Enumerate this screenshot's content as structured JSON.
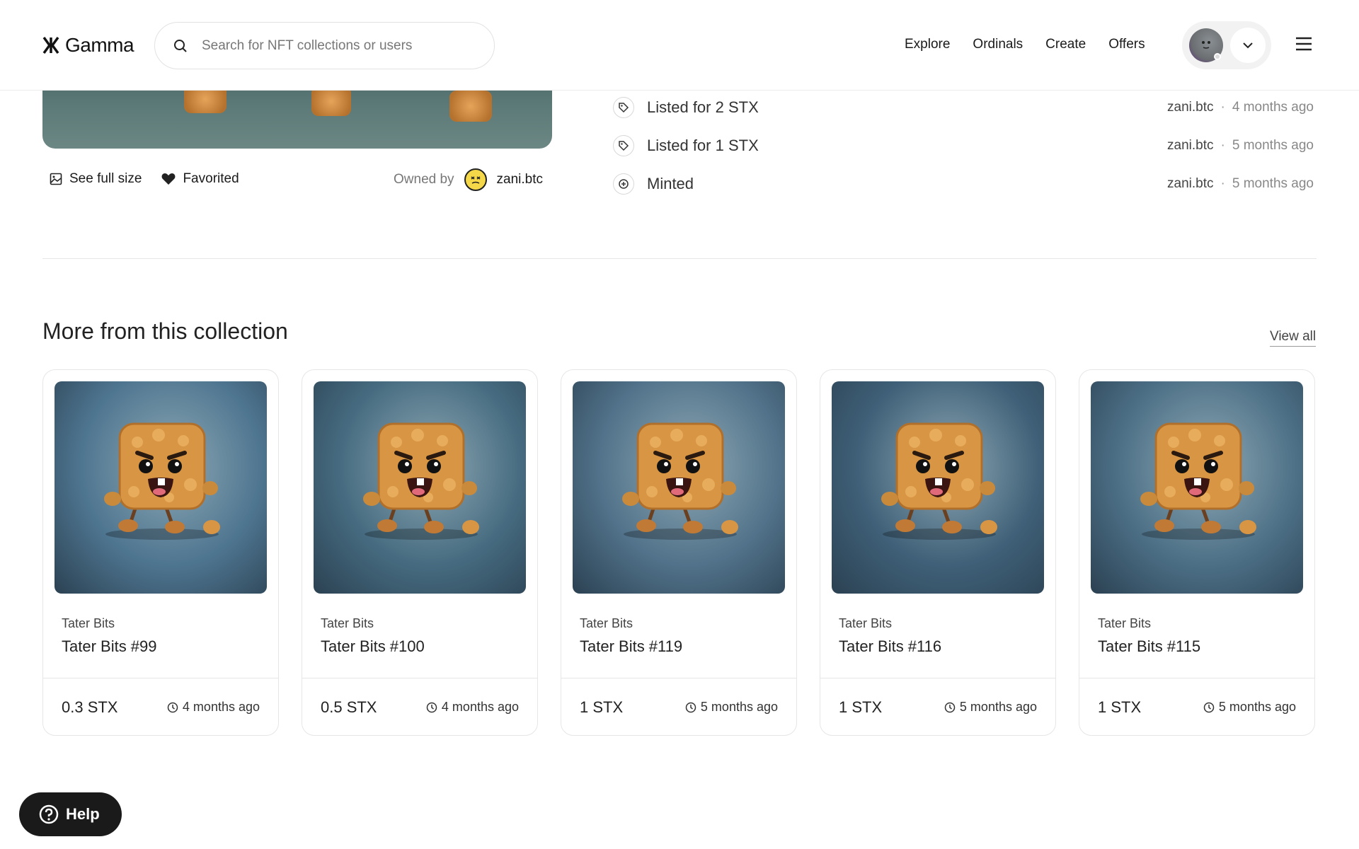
{
  "header": {
    "brand": "Gamma",
    "search_placeholder": "Search for NFT collections or users",
    "nav": [
      "Explore",
      "Ordinals",
      "Create",
      "Offers"
    ]
  },
  "item": {
    "see_full_size": "See full size",
    "favorited": "Favorited",
    "owned_by_label": "Owned by",
    "owner": "zani.btc"
  },
  "activity": [
    {
      "title": "Listed for 2 STX",
      "icon": "tag-icon",
      "user": "zani.btc",
      "time": "4 months ago"
    },
    {
      "title": "Listed for 1 STX",
      "icon": "tag-icon",
      "user": "zani.btc",
      "time": "5 months ago"
    },
    {
      "title": "Minted",
      "icon": "plus-circle-icon",
      "user": "zani.btc",
      "time": "5 months ago"
    }
  ],
  "collection_section": {
    "title": "More from this collection",
    "view_all": "View all",
    "cards": [
      {
        "collection": "Tater Bits",
        "name": "Tater Bits #99",
        "price": "0.3 STX",
        "time": "4 months ago"
      },
      {
        "collection": "Tater Bits",
        "name": "Tater Bits #100",
        "price": "0.5 STX",
        "time": "4 months ago"
      },
      {
        "collection": "Tater Bits",
        "name": "Tater Bits #119",
        "price": "1 STX",
        "time": "5 months ago"
      },
      {
        "collection": "Tater Bits",
        "name": "Tater Bits #116",
        "price": "1 STX",
        "time": "5 months ago"
      },
      {
        "collection": "Tater Bits",
        "name": "Tater Bits #115",
        "price": "1 STX",
        "time": "5 months ago"
      }
    ]
  },
  "help": "Help"
}
